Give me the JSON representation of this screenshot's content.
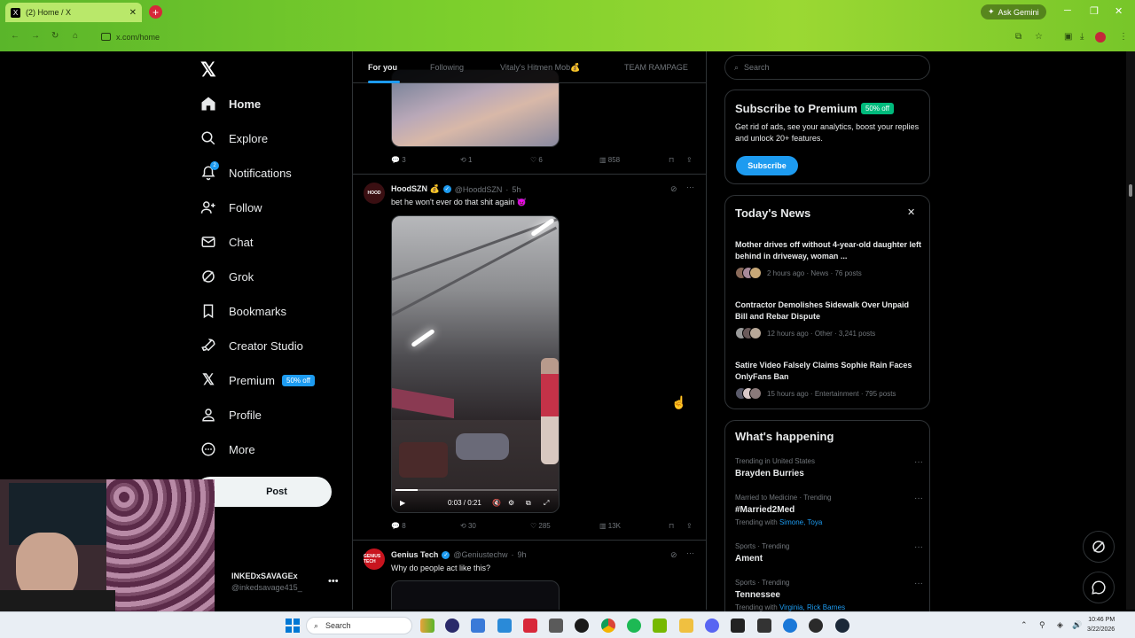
{
  "browser": {
    "tab_title": "(2) Home / X",
    "url": "x.com/home",
    "gemini_label": "Ask Gemini"
  },
  "nav": {
    "items": [
      {
        "label": "Home",
        "icon": "home-icon"
      },
      {
        "label": "Explore",
        "icon": "search-icon"
      },
      {
        "label": "Notifications",
        "icon": "bell-icon"
      },
      {
        "label": "Follow",
        "icon": "person-add-icon"
      },
      {
        "label": "Chat",
        "icon": "mail-icon"
      },
      {
        "label": "Grok",
        "icon": "grok-icon"
      },
      {
        "label": "Bookmarks",
        "icon": "bookmark-icon"
      },
      {
        "label": "Creator Studio",
        "icon": "rocket-icon"
      },
      {
        "label": "Premium",
        "icon": "x-icon"
      },
      {
        "label": "Profile",
        "icon": "person-icon"
      },
      {
        "label": "More",
        "icon": "more-circle-icon"
      }
    ],
    "premium_badge": "50% off",
    "notifications_count": "2",
    "post_label": "Post"
  },
  "account": {
    "name": "INKEDxSAVAGEx",
    "handle": "@inkedsavage415_"
  },
  "feed": {
    "tabs": [
      "For you",
      "Following",
      "Vitaly's Hitmen Mob💰",
      "TEAM RAMPAGE"
    ],
    "first_post_actions": {
      "replies": "3",
      "reposts": "1",
      "likes": "6",
      "views": "858"
    },
    "post": {
      "name": "HoodSZN 💰",
      "handle": "@HooddSZN",
      "time": "5h",
      "text": "bet he won't ever do that shit again 😈",
      "video_time": "0:03 / 0:21",
      "video_progress": 0.14,
      "avatar_text": "HOOD",
      "actions": {
        "replies": "8",
        "reposts": "30",
        "likes": "285",
        "views": "13K"
      }
    },
    "post2": {
      "name": "Genius Tech",
      "handle": "@Geniustechw",
      "time": "9h",
      "text": "Why do people act like this?",
      "avatar_text": "GENIUS TECH"
    }
  },
  "sidebar": {
    "search_placeholder": "Search",
    "premium": {
      "title": "Subscribe to Premium",
      "badge": "50% off",
      "text": "Get rid of ads, see your analytics, boost your replies and unlock 20+ features.",
      "button": "Subscribe"
    },
    "news": {
      "title": "Today's News",
      "items": [
        {
          "headline": "Mother drives off without 4-year-old daughter left behind in driveway, woman ...",
          "meta": "2 hours ago · News · 76 posts"
        },
        {
          "headline": "Contractor Demolishes Sidewalk Over Unpaid Bill and Rebar Dispute",
          "meta": "12 hours ago · Other · 3,241 posts"
        },
        {
          "headline": "Satire Video Falsely Claims Sophie Rain Faces OnlyFans Ban",
          "meta": "15 hours ago · Entertainment · 795 posts"
        }
      ]
    },
    "happening": {
      "title": "What's happening",
      "trends": [
        {
          "context": "Trending in United States",
          "name": "Brayden Burries",
          "with_label": "",
          "with_names": ""
        },
        {
          "context": "Married to Medicine · Trending",
          "name": "#Married2Med",
          "with_label": "Trending with",
          "with_names": "Simone, Toya"
        },
        {
          "context": "Sports · Trending",
          "name": "Ament",
          "with_label": "",
          "with_names": ""
        },
        {
          "context": "Sports · Trending",
          "name": "Tennessee",
          "with_label": "Trending with",
          "with_names": "Virginia, Rick Barnes"
        }
      ]
    }
  },
  "taskbar": {
    "search": "Search",
    "time": "10:46 PM",
    "date": "3/22/2026"
  },
  "colors": {
    "accent": "#1d9bf0",
    "premium_green": "#00ba7c",
    "browser_theme": "#7ccf2c"
  }
}
